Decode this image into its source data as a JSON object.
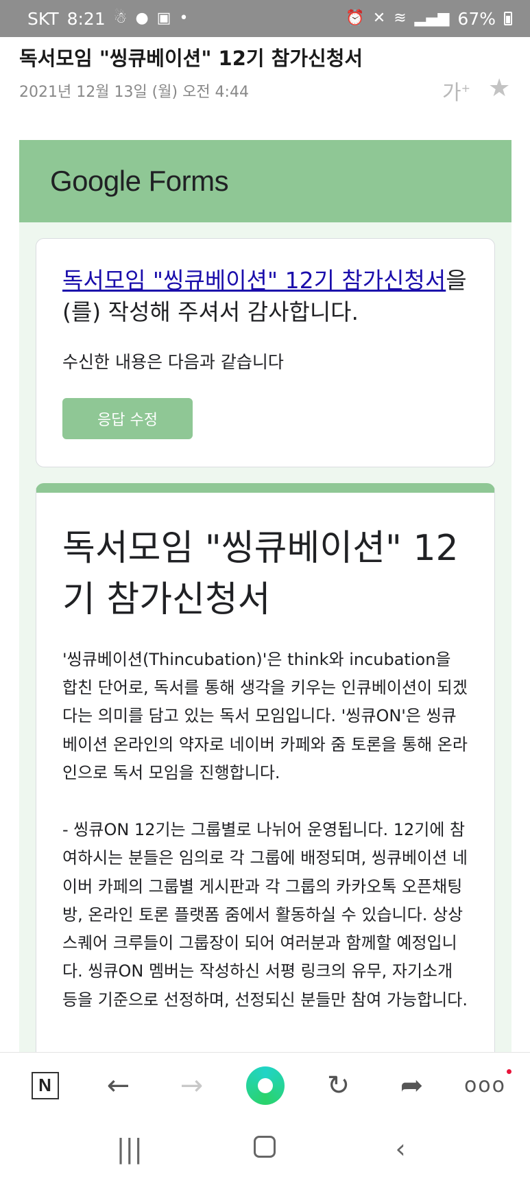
{
  "status_bar": {
    "carrier": "SKT",
    "time": "8:21",
    "battery": "67%",
    "icons": [
      "alarm-icon",
      "mute-icon",
      "wifi-icon",
      "signal-icon",
      "battery-icon"
    ]
  },
  "mail": {
    "subject": "독서모임 \"씽큐베이션\" 12기 참가신청서",
    "date": "2021년 12월 13일 (월) 오전 4:44",
    "font_size_icon": "가"
  },
  "forms": {
    "logo": "Google Forms",
    "thanks_link": "독서모임 \"씽큐베이션\" 12기 참가신청서",
    "thanks_suffix": "을(를) 작성해 주셔서 감사합니다.",
    "received_text": "수신한 내용은 다음과 같습니다",
    "edit_button": "응답 수정",
    "form_title": "독서모임 \"씽큐베이션\" 12기 참가신청서",
    "description_1": "'씽큐베이션(Thincubation)'은 think와 incubation을 합친 단어로, 독서를 통해 생각을 키우는 인큐베이션이 되겠다는 의미를 담고 있는 독서 모임입니다. '씽큐ON'은 씽큐베이션 온라인의 약자로 네이버 카페와 줌 토론을 통해 온라인으로 독서 모임을 진행합니다.",
    "description_2": "- 씽큐ON 12기는 그룹별로 나뉘어 운영됩니다. 12기에 참여하시는 분들은 임의로 각 그룹에 배정되며, 씽큐베이션 네이버 카페의 그룹별 게시판과 각 그룹의 카카오톡 오픈채팅방, 온라인 토론 플랫폼 줌에서 활동하실 수 있습니다. 상상스퀘어 크루들이 그룹장이 되어 여러분과 함께할 예정입니다. 씽큐ON 멤버는 작성하신 서평 링크의 유무, 자기소개 등을 기준으로 선정하며, 선정되신 분들만 참여 가능합니다."
  },
  "toolbar": {
    "naver_label": "N",
    "more_label": "ooo"
  },
  "colors": {
    "forms_green": "#8fc795",
    "forms_bg": "#eef7ef",
    "link": "#1a0dab",
    "status_bar": "#8e8e8e"
  }
}
